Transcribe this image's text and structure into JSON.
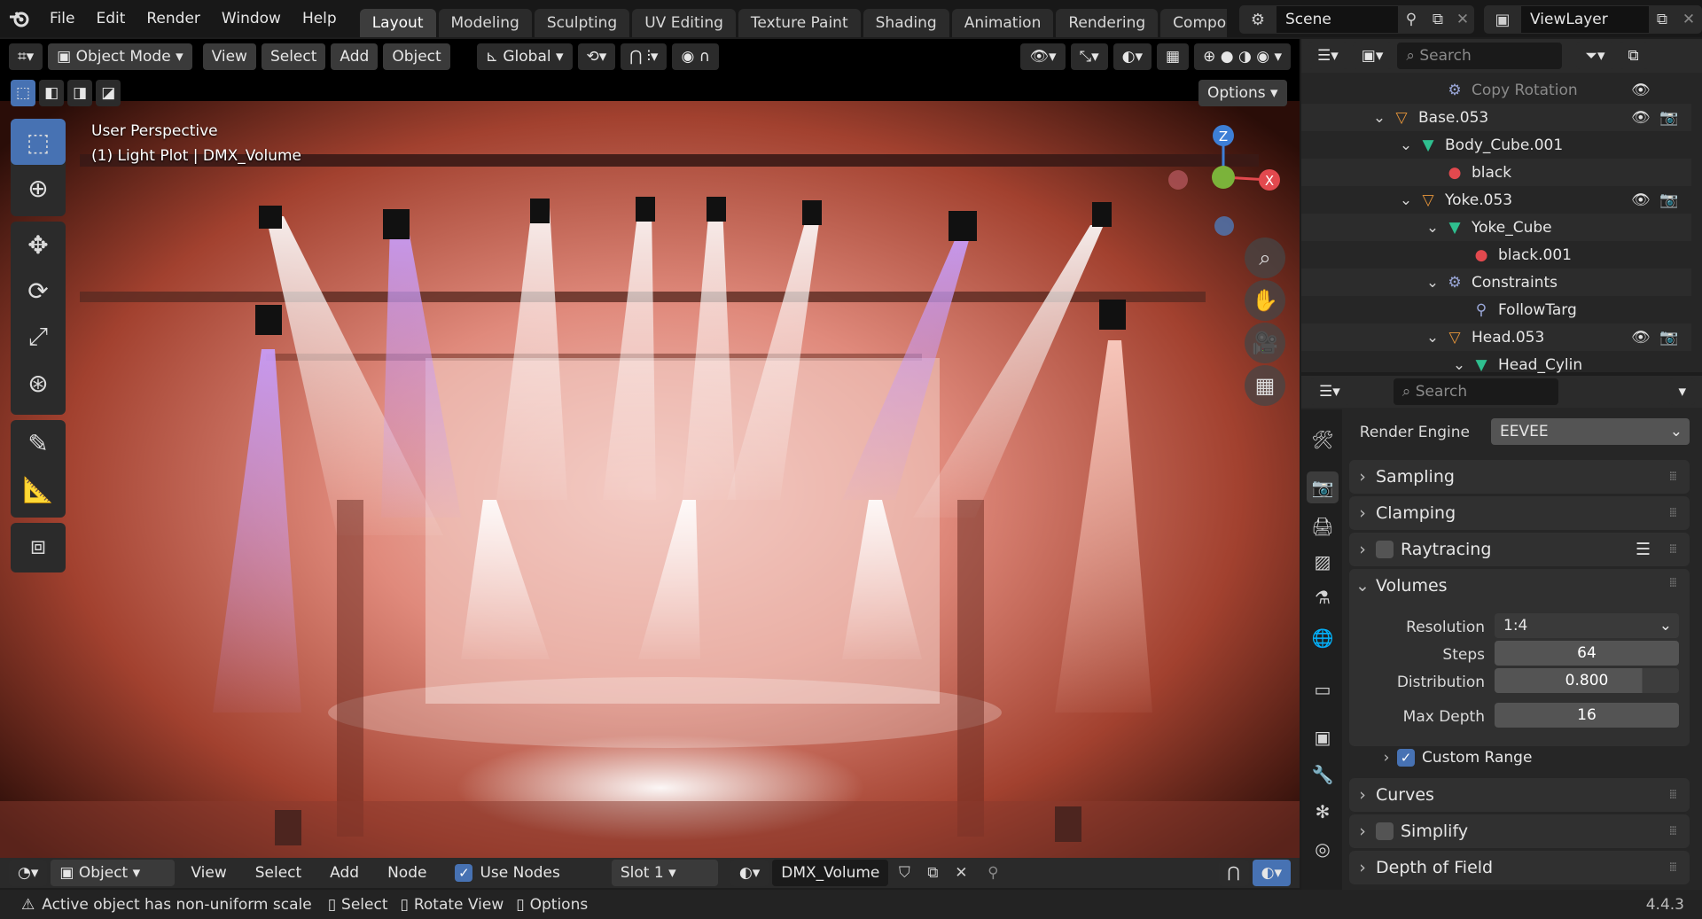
{
  "topbar": {
    "menus": [
      "File",
      "Edit",
      "Render",
      "Window",
      "Help"
    ],
    "workspaces": [
      "Layout",
      "Modeling",
      "Sculpting",
      "UV Editing",
      "Texture Paint",
      "Shading",
      "Animation",
      "Rendering",
      "Composi"
    ],
    "active_workspace": "Layout",
    "scene": "Scene",
    "view_layer": "ViewLayer"
  },
  "viewport_header": {
    "mode": "Object Mode",
    "menus": [
      "View",
      "Select",
      "Add",
      "Object"
    ],
    "orientation": "Global",
    "options_label": "Options"
  },
  "viewport": {
    "perspective_label": "User Perspective",
    "object_info": "(1) Light Plot | DMX_Volume",
    "gizmo_axes": {
      "z": "Z",
      "x": "X"
    },
    "colors": {
      "axis_x": "#e2494e",
      "axis_y": "#7bb33a",
      "axis_z": "#3d7fd6",
      "accent": "#4772b3"
    }
  },
  "tools": [
    "select-box",
    "cursor",
    "move",
    "rotate",
    "scale",
    "transform",
    "annotate",
    "measure",
    "add-cube"
  ],
  "bottom_header": {
    "editor_mode": "Object",
    "menus": [
      "View",
      "Select",
      "Add",
      "Node"
    ],
    "use_nodes_label": "Use Nodes",
    "use_nodes_checked": true,
    "slot": "Slot 1",
    "material": "DMX_Volume"
  },
  "status_bar": {
    "warning": "Active object has non-uniform scale",
    "hints": [
      "Select",
      "Rotate View",
      "Options"
    ],
    "version": "4.4.3"
  },
  "outliner": {
    "search_placeholder": "Search",
    "rows": [
      {
        "label": "Copy Rotation",
        "icon": "constraint-icon",
        "color": "#9aa7d8",
        "depth": 4,
        "dim": true,
        "eye": true,
        "cam": false,
        "expand": ""
      },
      {
        "label": "Base.053",
        "icon": "empty-icon",
        "color": "#e8963a",
        "depth": 2,
        "dim": false,
        "eye": true,
        "cam": true,
        "expand": "v"
      },
      {
        "label": "Body_Cube.001",
        "icon": "mesh-icon",
        "color": "#2fbf8f",
        "depth": 3,
        "dim": false,
        "eye": false,
        "cam": false,
        "expand": "v"
      },
      {
        "label": "black",
        "icon": "material-icon",
        "color": "#e2494e",
        "depth": 4,
        "dim": false,
        "eye": false,
        "cam": false,
        "expand": ""
      },
      {
        "label": "Yoke.053",
        "icon": "empty-icon",
        "color": "#e8963a",
        "depth": 3,
        "dim": false,
        "eye": true,
        "cam": true,
        "expand": "v"
      },
      {
        "label": "Yoke_Cube",
        "icon": "mesh-icon",
        "color": "#2fbf8f",
        "depth": 4,
        "dim": false,
        "eye": false,
        "cam": false,
        "expand": "v"
      },
      {
        "label": "black.001",
        "icon": "material-icon",
        "color": "#e2494e",
        "depth": 5,
        "dim": false,
        "eye": false,
        "cam": false,
        "expand": ""
      },
      {
        "label": "Constraints",
        "icon": "constraint-icon",
        "color": "#9aa7d8",
        "depth": 4,
        "dim": false,
        "eye": false,
        "cam": false,
        "expand": "v"
      },
      {
        "label": "FollowTarg",
        "icon": "follow-target-icon",
        "color": "#9aa7d8",
        "depth": 5,
        "dim": false,
        "eye": false,
        "cam": false,
        "expand": ""
      },
      {
        "label": "Head.053",
        "icon": "empty-icon",
        "color": "#e8963a",
        "depth": 4,
        "dim": false,
        "eye": true,
        "cam": true,
        "expand": "v"
      },
      {
        "label": "Head_Cylin",
        "icon": "mesh-icon",
        "color": "#2fbf8f",
        "depth": 5,
        "dim": false,
        "eye": false,
        "cam": false,
        "expand": "v"
      }
    ]
  },
  "properties": {
    "search_placeholder": "Search",
    "render_engine_label": "Render Engine",
    "render_engine": "EEVEE",
    "panels": {
      "sampling": "Sampling",
      "clamping": "Clamping",
      "raytracing": "Raytracing",
      "volumes": "Volumes",
      "curves": "Curves",
      "simplify": "Simplify",
      "dof": "Depth of Field"
    },
    "volumes": {
      "resolution_label": "Resolution",
      "resolution": "1:4",
      "steps_label": "Steps",
      "steps": "64",
      "distribution_label": "Distribution",
      "distribution": "0.800",
      "max_depth_label": "Max Depth",
      "max_depth": "16",
      "custom_range_label": "Custom Range",
      "custom_range_checked": true
    }
  }
}
